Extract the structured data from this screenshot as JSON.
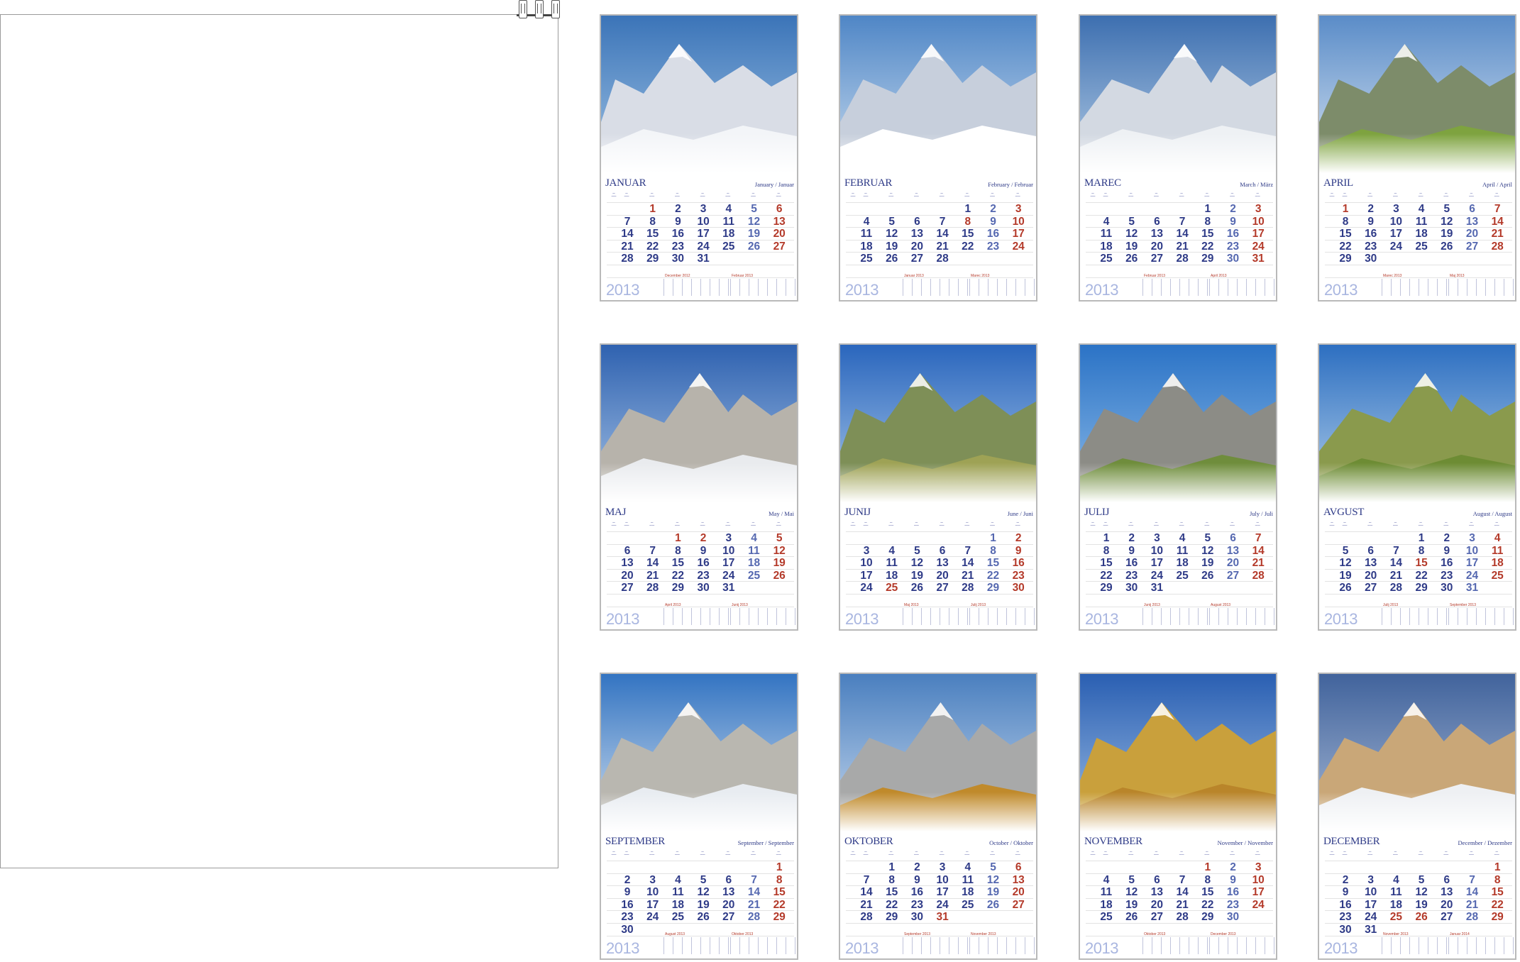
{
  "year": "2013",
  "months": [
    {
      "name": "JANUAR",
      "sub": "January / Januar",
      "sky": [
        "#3b74b8",
        "#9fc3e5"
      ],
      "mtn": "#d9dde6",
      "ground": "#f3f5f8",
      "first": 1,
      "days": 31,
      "sundays": [
        6,
        13,
        20,
        27
      ],
      "holidays": [
        1
      ],
      "prev": "December 2012",
      "next": "Februar 2013"
    },
    {
      "name": "FEBRUAR",
      "sub": "February / Februar",
      "sky": [
        "#4f86c6",
        "#c9dcef"
      ],
      "mtn": "#c7cfdc",
      "ground": "#ffffff",
      "first": 4,
      "days": 28,
      "sundays": [
        3,
        10,
        17,
        24
      ],
      "holidays": [
        8
      ],
      "prev": "Januar 2013",
      "next": "Marec 2013"
    },
    {
      "name": "MAREC",
      "sub": "March / März",
      "sky": [
        "#3d6fb0",
        "#b4cde6"
      ],
      "mtn": "#d3d9e2",
      "ground": "#eef1f4",
      "first": 4,
      "days": 31,
      "sundays": [
        3,
        10,
        17,
        24,
        31
      ],
      "holidays": [],
      "prev": "Februar 2013",
      "next": "April 2013"
    },
    {
      "name": "APRIL",
      "sub": "April / April",
      "sky": [
        "#5a8cc8",
        "#d6e3f1"
      ],
      "mtn": "#7d8c6a",
      "ground": "#7ea33f",
      "first": 0,
      "days": 30,
      "sundays": [
        7,
        14,
        21,
        28
      ],
      "holidays": [
        1
      ],
      "prev": "Marec 2013",
      "next": "Maj 2013"
    },
    {
      "name": "MAJ",
      "sub": "May / Mai",
      "sky": [
        "#2f62b0",
        "#a6c3e6"
      ],
      "mtn": "#b7b3ab",
      "ground": "#e9ebee",
      "first": 2,
      "days": 31,
      "sundays": [
        5,
        12,
        19,
        26
      ],
      "holidays": [
        1,
        2
      ],
      "prev": "April 2013",
      "next": "Junij 2013"
    },
    {
      "name": "JUNIJ",
      "sub": "June / Juni",
      "sky": [
        "#2a66bd",
        "#a9c8ea"
      ],
      "mtn": "#7e8f57",
      "ground": "#9ea255",
      "first": 5,
      "days": 30,
      "sundays": [
        2,
        9,
        16,
        23,
        30
      ],
      "holidays": [
        25
      ],
      "prev": "Maj 2013",
      "next": "Julij 2013"
    },
    {
      "name": "JULIJ",
      "sub": "July / Juli",
      "sky": [
        "#2b73c6",
        "#8dbbe8"
      ],
      "mtn": "#8c8c86",
      "ground": "#6f8d3c",
      "first": 0,
      "days": 31,
      "sundays": [
        7,
        14,
        21,
        28
      ],
      "holidays": [],
      "prev": "Junij 2013",
      "next": "August 2013"
    },
    {
      "name": "AVGUST",
      "sub": "August / August",
      "sky": [
        "#2d6fc1",
        "#b2cfea"
      ],
      "mtn": "#8a9a4d",
      "ground": "#6d8c34",
      "first": 3,
      "days": 31,
      "sundays": [
        4,
        11,
        18,
        25
      ],
      "holidays": [
        15
      ],
      "prev": "Julij 2013",
      "next": "September 2013"
    },
    {
      "name": "SEPTEMBER",
      "sub": "September / September",
      "sky": [
        "#3374c2",
        "#d2e0ef"
      ],
      "mtn": "#b9b7b0",
      "ground": "#e8ecf1",
      "first": 6,
      "days": 30,
      "sundays": [
        1,
        8,
        15,
        22,
        29
      ],
      "holidays": [],
      "prev": "August 2013",
      "next": "Oktober 2013"
    },
    {
      "name": "OKTOBER",
      "sub": "October / Oktober",
      "sky": [
        "#4a7fbf",
        "#c7d9ee"
      ],
      "mtn": "#a8a9a9",
      "ground": "#c08a2b",
      "first": 1,
      "days": 31,
      "sundays": [
        6,
        13,
        20,
        27
      ],
      "holidays": [
        31
      ],
      "prev": "September 2013",
      "next": "November 2013"
    },
    {
      "name": "NOVEMBER",
      "sub": "November / November",
      "sky": [
        "#2a5fb2",
        "#9ebfe6"
      ],
      "mtn": "#c9a03c",
      "ground": "#b9852a",
      "first": 4,
      "days": 30,
      "sundays": [
        3,
        10,
        17,
        24
      ],
      "holidays": [
        1
      ],
      "prev": "Oktober 2013",
      "next": "December 2013"
    },
    {
      "name": "DECEMBER",
      "sub": "December / Dezember",
      "sky": [
        "#41639c",
        "#a8bad6"
      ],
      "mtn": "#c9a778",
      "ground": "#eef0f3",
      "first": 6,
      "days": 31,
      "sundays": [
        1,
        8,
        15,
        22,
        29
      ],
      "holidays": [
        25,
        26
      ],
      "prev": "November 2013",
      "next": "Januar 2014"
    }
  ]
}
